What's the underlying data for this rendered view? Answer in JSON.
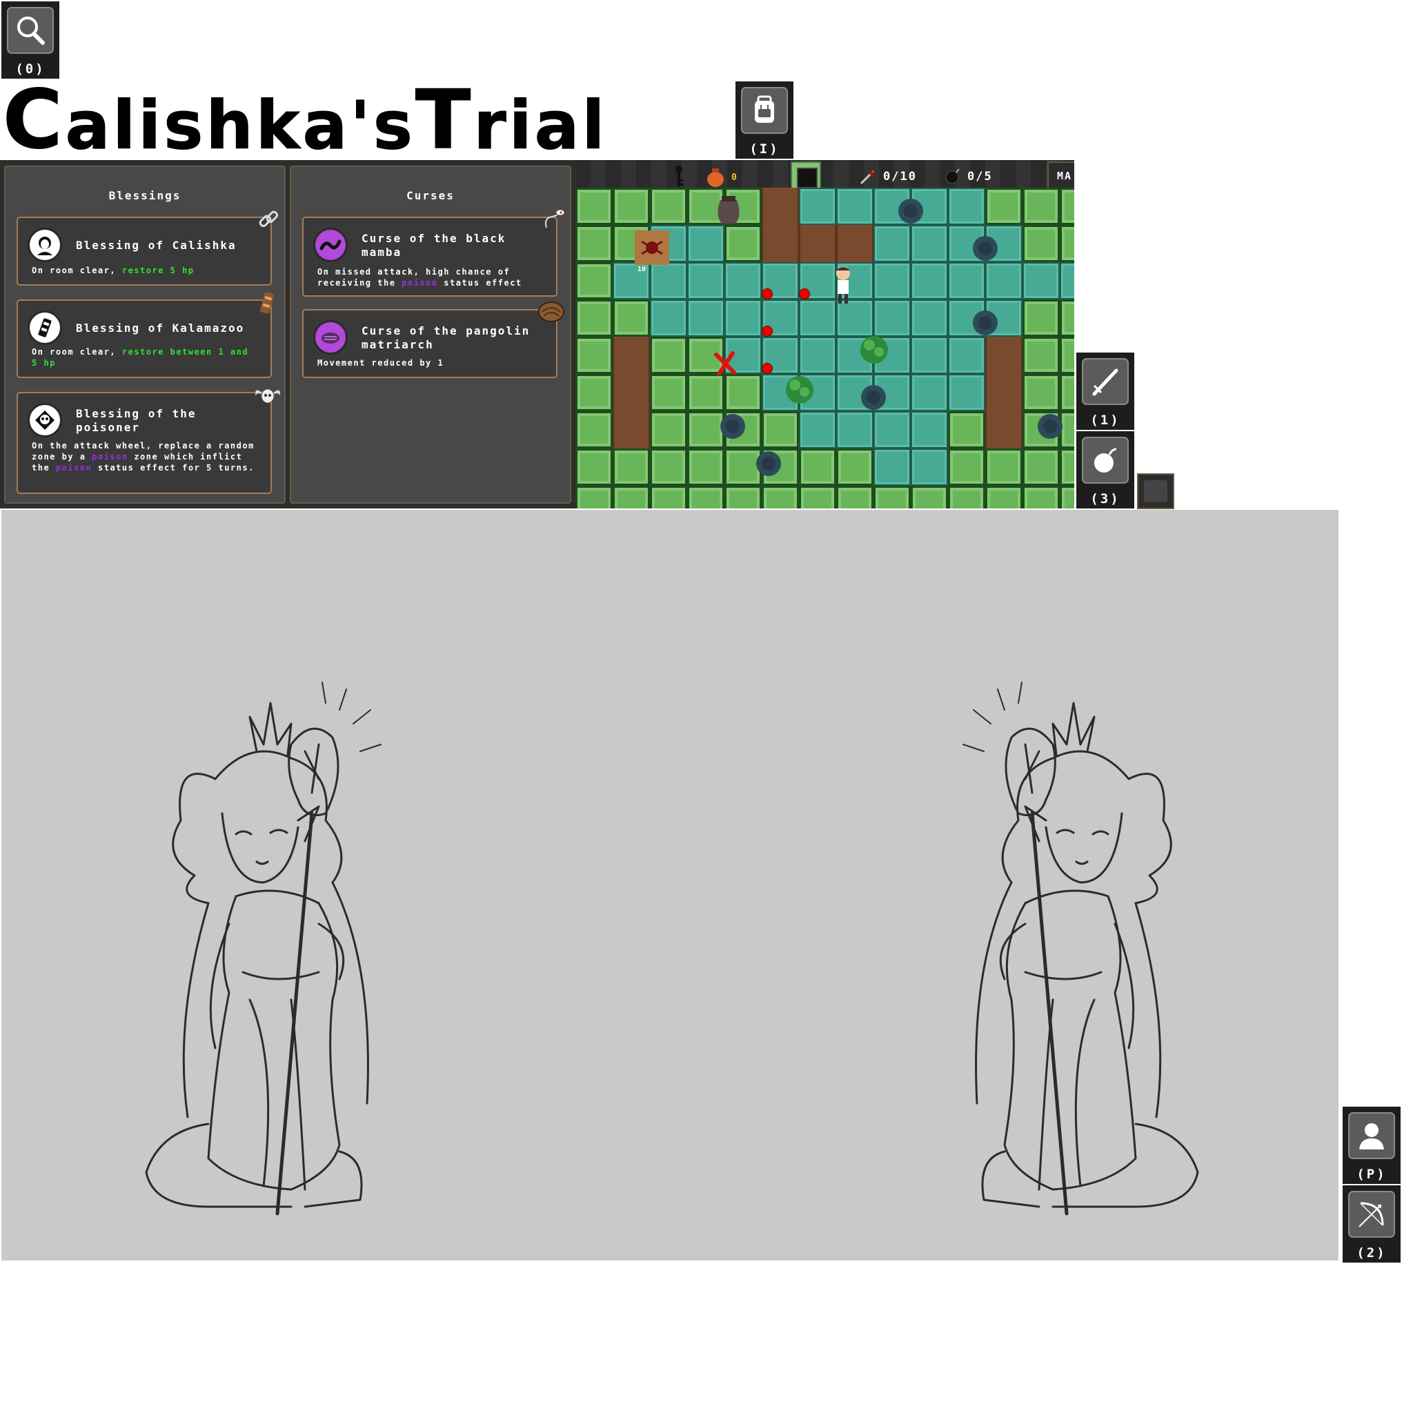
{
  "hotkeys": {
    "search": "(0)",
    "inventory": "(I)",
    "sword": "(1)",
    "bomb": "(3)",
    "profile": "(P)",
    "bow": "(2)"
  },
  "title": {
    "first_cap": "C",
    "first_rest": "alishka's ",
    "second_cap": "T",
    "second_rest": "rial"
  },
  "blessings": {
    "heading": "Blessings",
    "items": [
      {
        "name": "Blessing of Calishka",
        "desc_pre": "On room clear, ",
        "desc_hl": "restore 5 hp",
        "desc_post": "",
        "avatar": "portrait-icon",
        "badge": "chain-link-icon"
      },
      {
        "name": "Blessing of Kalamazoo",
        "desc_pre": "On room clear, ",
        "desc_hl": "restore between 1 and 5 hp",
        "desc_post": "",
        "avatar": "totem-icon",
        "badge": "tiki-totem-icon"
      },
      {
        "name": "Blessing of the poisoner",
        "desc_pre": "On the attack wheel, replace a random zone by a ",
        "desc_hl": "poison",
        "desc_mid": " zone which inflict the ",
        "desc_hl2": "poison",
        "desc_post": " status effect for 5 turns.",
        "avatar": "skull-icon",
        "badge": "ram-skull-icon"
      }
    ]
  },
  "curses": {
    "heading": "Curses",
    "items": [
      {
        "name": "Curse of the black mamba",
        "desc_pre": "On missed attack, high chance of receiving the ",
        "desc_hl": "poison",
        "desc_post": " status effect",
        "avatar": "snake-icon",
        "badge": "snake-badge-icon"
      },
      {
        "name": "Curse of the pangolin matriarch",
        "desc_pre": "Movement reduced by 1",
        "desc_hl": "",
        "desc_post": "",
        "avatar": "pangolin-icon",
        "badge": "shell-icon"
      }
    ]
  },
  "hud": {
    "gold": "0",
    "arrows": "0/10",
    "bombs": "0/5",
    "map_label": "MA"
  },
  "board": {
    "enemy_level": "10"
  }
}
